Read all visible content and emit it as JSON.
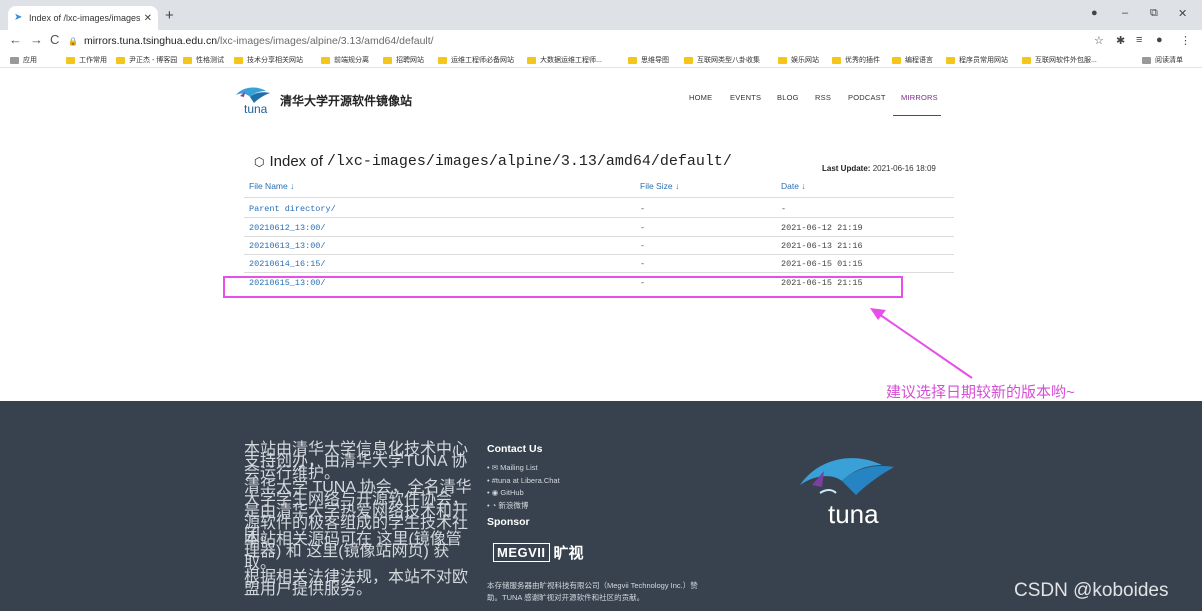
{
  "browser": {
    "tab_title": "Index of /lxc-images/images/a",
    "url_host": "mirrors.tuna.tsinghua.edu.cn",
    "url_path": "/lxc-images/images/alpine/3.13/amd64/default/",
    "bookmarks": [
      "应用",
      "工作常用",
      "尹正杰 - 博客园",
      "性格测试",
      "技术分享相关网站",
      "前端规分离",
      "招聘网站",
      "运维工程师必备网站",
      "大数据运维工程师...",
      "思维导图",
      "互联网类型八卦收集",
      "娱乐网站",
      "优秀的插件",
      "编程语言",
      "程序员常用网站",
      "互联网软件外包服...",
      "阅读清单"
    ]
  },
  "site": {
    "title": "清华大学开源软件镜像站",
    "logo_text": "tuna",
    "nav": [
      "HOME",
      "EVENTS",
      "BLOG",
      "RSS",
      "PODCAST",
      "MIRRORS"
    ]
  },
  "index": {
    "label": "Index of",
    "path": "/lxc-images/images/alpine/3.13/amd64/default/",
    "last_update_label": "Last Update:",
    "last_update": "2021-06-16 18:09",
    "columns": [
      "File Name ↓",
      "File Size ↓",
      "Date ↓"
    ],
    "rows": [
      {
        "name": "Parent directory/",
        "size": "-",
        "date": "-"
      },
      {
        "name": "20210612_13:00/",
        "size": "-",
        "date": "2021-06-12 21:19"
      },
      {
        "name": "20210613_13:00/",
        "size": "-",
        "date": "2021-06-13 21:16"
      },
      {
        "name": "20210614_16:15/",
        "size": "-",
        "date": "2021-06-15 01:15"
      },
      {
        "name": "20210615_13:00/",
        "size": "-",
        "date": "2021-06-15 21:15"
      }
    ]
  },
  "annotation": "建议选择日期较新的版本哟~",
  "footer": {
    "p1": "本站由清华大学信息化技术中心支持创办，由清华大学TUNA 协会运行维护。",
    "p2": "清华大学 TUNA 协会，全名清华大学学生网络与开源软件协会，是由清华大学热爱网络技术和开源软件的极客组成的学生技术社团。",
    "p3": "本站相关源码可在 这里(镜像管理器) 和 这里(镜像站网页) 获取。",
    "p4": "根据相关法律法规，本站不对欧盟用户提供服务。",
    "contact_title": "Contact Us",
    "contacts": [
      "✉ Mailing List",
      "#tuna at Libera.Chat",
      "GitHub",
      "新浪微博"
    ],
    "sponsor_title": "Sponsor",
    "sponsor_logo": "MEGVII",
    "sponsor_logo_cn": "旷视",
    "sponsor_note": "本存储服务器由旷视科技有限公司（Megvii Technology Inc.）赞助。TUNA 感谢旷视对开源软件和社区的贡献。",
    "big_logo_text": "tuna"
  },
  "watermark": "CSDN @koboides",
  "colors": {
    "accent": "#7b2a8d",
    "link": "#2a6fb5",
    "highlight": "#e84ee8",
    "footer_bg": "#38424e"
  }
}
